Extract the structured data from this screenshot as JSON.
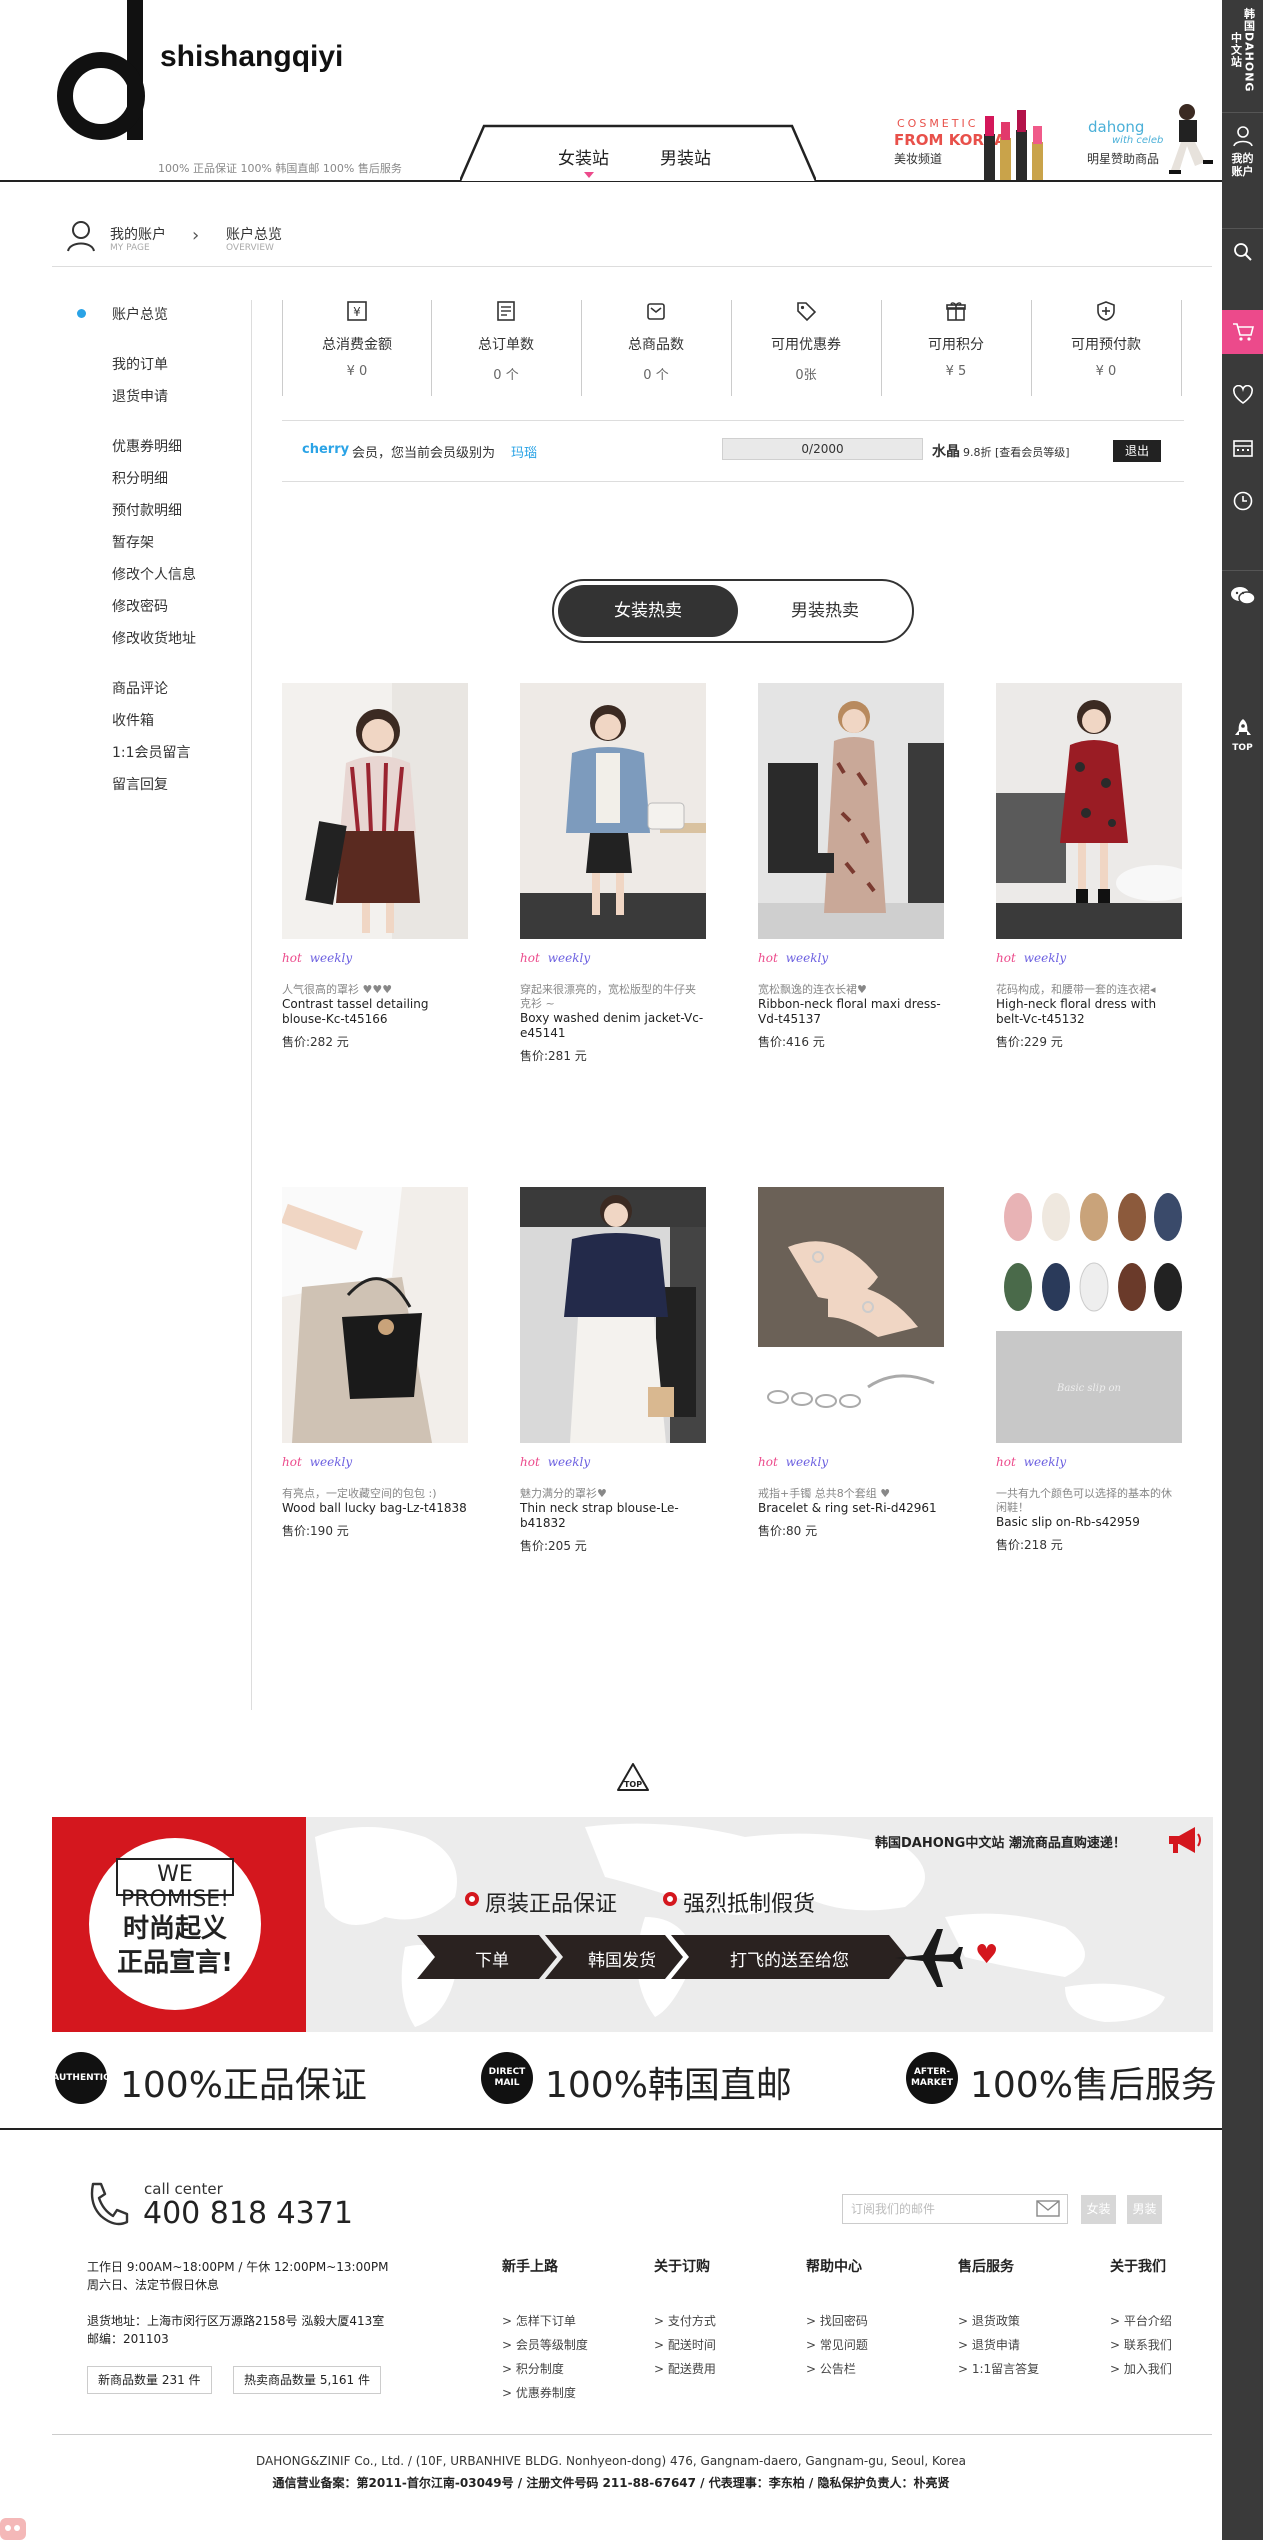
{
  "header": {
    "brand": "shishangqiyi",
    "guarantee": "100% 正品保证  100% 韩国直邮  100% 售后服务",
    "tabs": [
      "女装站",
      "男装站"
    ],
    "cosmetic": {
      "en": "COSMETIC",
      "sub": "FROM KOREA",
      "ch": "美妆频道"
    },
    "dahong": {
      "en": "dahong",
      "sub": "with celeb",
      "ch": "明星赞助商品"
    }
  },
  "sidebar_right": {
    "top_label": "韩国DAHONG中文站",
    "account_label": "我的账户",
    "top_btn": "TOP"
  },
  "breadcrumb": {
    "my": "我的账户",
    "my_en": "MY PAGE",
    "overview": "账户总览",
    "overview_en": "OVERVIEW"
  },
  "sidebar": {
    "items": [
      "账户总览",
      "我的订单",
      "退货申请",
      "优惠券明细",
      "积分明细",
      "预付款明细",
      "暂存架",
      "修改个人信息",
      "修改密码",
      "修改收货地址",
      "商品评论",
      "收件箱",
      "1:1会员留言",
      "留言回复"
    ]
  },
  "stats": [
    {
      "icon": "yen-icon",
      "label": "总消费金额",
      "value": "¥ 0"
    },
    {
      "icon": "order-list-icon",
      "label": "总订单数",
      "value": "0 个"
    },
    {
      "icon": "box-icon",
      "label": "总商品数",
      "value": "0 个"
    },
    {
      "icon": "coupon-tag-icon",
      "label": "可用优惠券",
      "value": "0张"
    },
    {
      "icon": "gift-icon",
      "label": "可用积分",
      "value": "¥ 5"
    },
    {
      "icon": "shield-icon",
      "label": "可用预付款",
      "value": "¥ 0"
    }
  ],
  "member": {
    "name": "cherry",
    "text": "会员，您当前会员级别为",
    "level": "玛瑙",
    "progress": "0/2000",
    "progress_fraction": 0,
    "crystal": "水晶",
    "crystal_detail": "9.8折 [查看会员等级]",
    "logout": "退出"
  },
  "toggle": {
    "women": "女装热卖",
    "men": "男装热卖"
  },
  "products": [
    {
      "hot": "hot",
      "weekly": "weekly",
      "desc": "人气很高的罩衫 ♥♥♥",
      "name": "Contrast tassel detailing blouse-Kc-t45166",
      "price": "售价:282 元"
    },
    {
      "hot": "hot",
      "weekly": "weekly",
      "desc": "穿起来很漂亮的，宽松版型的牛仔夹克衫 ~",
      "name": "Boxy washed denim jacket-Vc-e45141",
      "price": "售价:281 元"
    },
    {
      "hot": "hot",
      "weekly": "weekly",
      "desc": "宽松飘逸的连衣长裙♥",
      "name": "Ribbon-neck floral maxi dress-Vd-t45137",
      "price": "售价:416 元"
    },
    {
      "hot": "hot",
      "weekly": "weekly",
      "desc": "花码构成，和腰带一套的连衣裙◂",
      "name": "High-neck floral dress with belt-Vc-t45132",
      "price": "售价:229 元"
    },
    {
      "hot": "hot",
      "weekly": "weekly",
      "desc": "有亮点，一定收藏空间的包包 :)",
      "name": "Wood ball lucky bag-Lz-t41838",
      "price": "售价:190 元"
    },
    {
      "hot": "hot",
      "weekly": "weekly",
      "desc": "魅力满分的罩衫♥",
      "name": "Thin neck strap blouse-Le-b41832",
      "price": "售价:205 元"
    },
    {
      "hot": "hot",
      "weekly": "weekly",
      "desc": "戒指+手镯 总共8个套组 ♥",
      "name": "Bracelet & ring set-Ri-d42961",
      "price": "售价:80 元"
    },
    {
      "hot": "hot",
      "weekly": "weekly",
      "desc": "一共有九个颜色可以选择的基本的休闲鞋！",
      "name": "Basic slip on-Rb-s42959",
      "price": "售价:218 元"
    }
  ],
  "top_link": "TOP",
  "banner": {
    "we_promise": "WE PROMISE!",
    "line1": "时尚起义",
    "line2": "正品宣言!",
    "headline": "韩国DAHONG中文站  潮流商品直购速递！",
    "point1": "原装正品保证",
    "point2": "强烈抵制假货",
    "steps": [
      "下单",
      "韩国发货",
      "打飞的送至给您"
    ]
  },
  "promises": [
    {
      "badge": "AUTHENTIC",
      "text": "100%正品保证"
    },
    {
      "badge": "DIRECT MAIL",
      "text": "100%韩国直邮"
    },
    {
      "badge": "AFTER-MARKET",
      "text": "100%售后服务"
    }
  ],
  "footer": {
    "cc_label": "call center",
    "cc_number": "400 818 4371",
    "subscribe_placeholder": "订阅我们的邮件",
    "btn_women": "女装",
    "btn_men": "男装",
    "hours1": "工作日 9:00AM~18:00PM / 午休 12:00PM~13:00PM",
    "hours2": "周六日、法定节假日休息",
    "addr1": "退货地址：上海市闵行区万源路2158号 泓毅大厦413室",
    "addr2": "邮编：201103",
    "new_count": "新商品数量 231 件",
    "hot_count": "热卖商品数量 5,161 件",
    "columns": [
      {
        "title": "新手上路",
        "items": [
          "> 怎样下订单",
          "> 会员等级制度",
          "> 积分制度",
          "> 优惠券制度"
        ]
      },
      {
        "title": "关于订购",
        "items": [
          "> 支付方式",
          "> 配送时间",
          "> 配送费用"
        ]
      },
      {
        "title": "帮助中心",
        "items": [
          "> 找回密码",
          "> 常见问题",
          "> 公告栏"
        ]
      },
      {
        "title": "售后服务",
        "items": [
          "> 退货政策",
          "> 退货申请",
          "> 1:1留言答复"
        ]
      },
      {
        "title": "关于我们",
        "items": [
          "> 平台介绍",
          "> 联系我们",
          "> 加入我们"
        ]
      }
    ],
    "company": "DAHONG&ZINIF Co., Ltd. / (10F, URBANHIVE BLDG. Nonhyeon-dong) 476, Gangnam-daero, Gangnam-gu, Seoul, Korea",
    "reg": "通信营业备案：第2011-首尔江南-03049号 / 注册文件号码 211-88-67647 / 代表理事：李东柏 / 隐私保护负责人：朴亮贤"
  }
}
